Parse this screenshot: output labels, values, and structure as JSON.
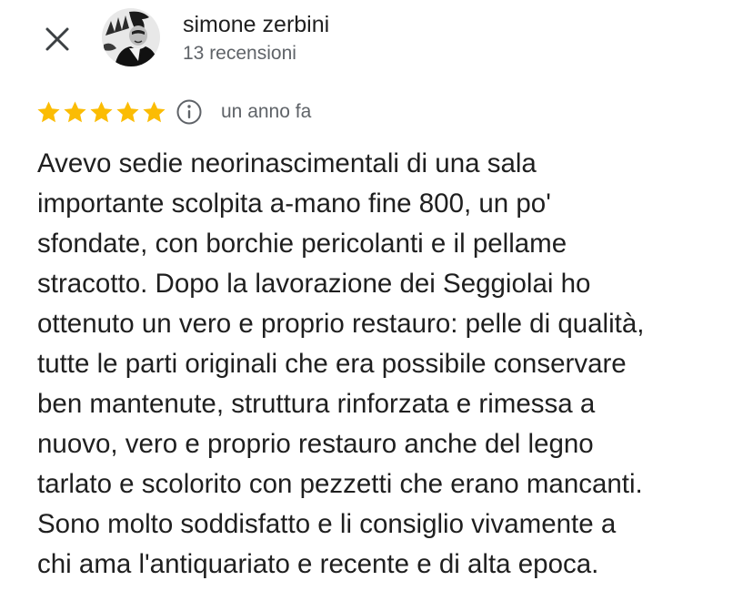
{
  "header": {
    "close_icon": "close-icon",
    "avatar_icon": "user-avatar",
    "user_name": "simone zerbini",
    "review_count": "13 recensioni"
  },
  "review": {
    "rating": 5,
    "max_rating": 5,
    "star_color": "#fbbc04",
    "info_icon": "info-icon",
    "date": "un anno fa",
    "text": "Avevo sedie neorinascimentali di una sala\nimportante scolpita a-mano fine 800, un po'\nsfondate, con borchie pericolanti e il pellame\nstracotto. Dopo la lavorazione dei Seggiolai ho\nottenuto un vero e proprio restauro: pelle di qualità,\ntutte le parti originali che era possibile conservare\nben mantenute, struttura rinforzata e rimessa a\nnuovo, vero e proprio restauro anche del legno\ntarlato e scolorito con pezzetti che erano mancanti.\nSono molto soddisfatto e li consiglio vivamente a\nchi ama l'antiquariato e recente e di alta epoca."
  },
  "colors": {
    "text_primary": "#1f1f1f",
    "text_secondary": "#5f6368",
    "background": "#ffffff"
  }
}
